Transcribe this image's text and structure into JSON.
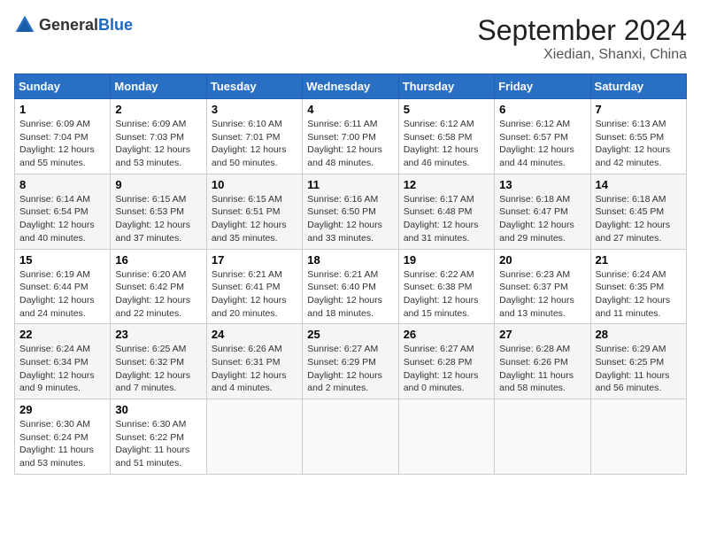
{
  "header": {
    "logo_general": "General",
    "logo_blue": "Blue",
    "month": "September 2024",
    "location": "Xiedian, Shanxi, China"
  },
  "days_of_week": [
    "Sunday",
    "Monday",
    "Tuesday",
    "Wednesday",
    "Thursday",
    "Friday",
    "Saturday"
  ],
  "weeks": [
    [
      {
        "day": "1",
        "info": "Sunrise: 6:09 AM\nSunset: 7:04 PM\nDaylight: 12 hours\nand 55 minutes."
      },
      {
        "day": "2",
        "info": "Sunrise: 6:09 AM\nSunset: 7:03 PM\nDaylight: 12 hours\nand 53 minutes."
      },
      {
        "day": "3",
        "info": "Sunrise: 6:10 AM\nSunset: 7:01 PM\nDaylight: 12 hours\nand 50 minutes."
      },
      {
        "day": "4",
        "info": "Sunrise: 6:11 AM\nSunset: 7:00 PM\nDaylight: 12 hours\nand 48 minutes."
      },
      {
        "day": "5",
        "info": "Sunrise: 6:12 AM\nSunset: 6:58 PM\nDaylight: 12 hours\nand 46 minutes."
      },
      {
        "day": "6",
        "info": "Sunrise: 6:12 AM\nSunset: 6:57 PM\nDaylight: 12 hours\nand 44 minutes."
      },
      {
        "day": "7",
        "info": "Sunrise: 6:13 AM\nSunset: 6:55 PM\nDaylight: 12 hours\nand 42 minutes."
      }
    ],
    [
      {
        "day": "8",
        "info": "Sunrise: 6:14 AM\nSunset: 6:54 PM\nDaylight: 12 hours\nand 40 minutes."
      },
      {
        "day": "9",
        "info": "Sunrise: 6:15 AM\nSunset: 6:53 PM\nDaylight: 12 hours\nand 37 minutes."
      },
      {
        "day": "10",
        "info": "Sunrise: 6:15 AM\nSunset: 6:51 PM\nDaylight: 12 hours\nand 35 minutes."
      },
      {
        "day": "11",
        "info": "Sunrise: 6:16 AM\nSunset: 6:50 PM\nDaylight: 12 hours\nand 33 minutes."
      },
      {
        "day": "12",
        "info": "Sunrise: 6:17 AM\nSunset: 6:48 PM\nDaylight: 12 hours\nand 31 minutes."
      },
      {
        "day": "13",
        "info": "Sunrise: 6:18 AM\nSunset: 6:47 PM\nDaylight: 12 hours\nand 29 minutes."
      },
      {
        "day": "14",
        "info": "Sunrise: 6:18 AM\nSunset: 6:45 PM\nDaylight: 12 hours\nand 27 minutes."
      }
    ],
    [
      {
        "day": "15",
        "info": "Sunrise: 6:19 AM\nSunset: 6:44 PM\nDaylight: 12 hours\nand 24 minutes."
      },
      {
        "day": "16",
        "info": "Sunrise: 6:20 AM\nSunset: 6:42 PM\nDaylight: 12 hours\nand 22 minutes."
      },
      {
        "day": "17",
        "info": "Sunrise: 6:21 AM\nSunset: 6:41 PM\nDaylight: 12 hours\nand 20 minutes."
      },
      {
        "day": "18",
        "info": "Sunrise: 6:21 AM\nSunset: 6:40 PM\nDaylight: 12 hours\nand 18 minutes."
      },
      {
        "day": "19",
        "info": "Sunrise: 6:22 AM\nSunset: 6:38 PM\nDaylight: 12 hours\nand 15 minutes."
      },
      {
        "day": "20",
        "info": "Sunrise: 6:23 AM\nSunset: 6:37 PM\nDaylight: 12 hours\nand 13 minutes."
      },
      {
        "day": "21",
        "info": "Sunrise: 6:24 AM\nSunset: 6:35 PM\nDaylight: 12 hours\nand 11 minutes."
      }
    ],
    [
      {
        "day": "22",
        "info": "Sunrise: 6:24 AM\nSunset: 6:34 PM\nDaylight: 12 hours\nand 9 minutes."
      },
      {
        "day": "23",
        "info": "Sunrise: 6:25 AM\nSunset: 6:32 PM\nDaylight: 12 hours\nand 7 minutes."
      },
      {
        "day": "24",
        "info": "Sunrise: 6:26 AM\nSunset: 6:31 PM\nDaylight: 12 hours\nand 4 minutes."
      },
      {
        "day": "25",
        "info": "Sunrise: 6:27 AM\nSunset: 6:29 PM\nDaylight: 12 hours\nand 2 minutes."
      },
      {
        "day": "26",
        "info": "Sunrise: 6:27 AM\nSunset: 6:28 PM\nDaylight: 12 hours\nand 0 minutes."
      },
      {
        "day": "27",
        "info": "Sunrise: 6:28 AM\nSunset: 6:26 PM\nDaylight: 11 hours\nand 58 minutes."
      },
      {
        "day": "28",
        "info": "Sunrise: 6:29 AM\nSunset: 6:25 PM\nDaylight: 11 hours\nand 56 minutes."
      }
    ],
    [
      {
        "day": "29",
        "info": "Sunrise: 6:30 AM\nSunset: 6:24 PM\nDaylight: 11 hours\nand 53 minutes."
      },
      {
        "day": "30",
        "info": "Sunrise: 6:30 AM\nSunset: 6:22 PM\nDaylight: 11 hours\nand 51 minutes."
      },
      {
        "day": "",
        "info": ""
      },
      {
        "day": "",
        "info": ""
      },
      {
        "day": "",
        "info": ""
      },
      {
        "day": "",
        "info": ""
      },
      {
        "day": "",
        "info": ""
      }
    ]
  ]
}
